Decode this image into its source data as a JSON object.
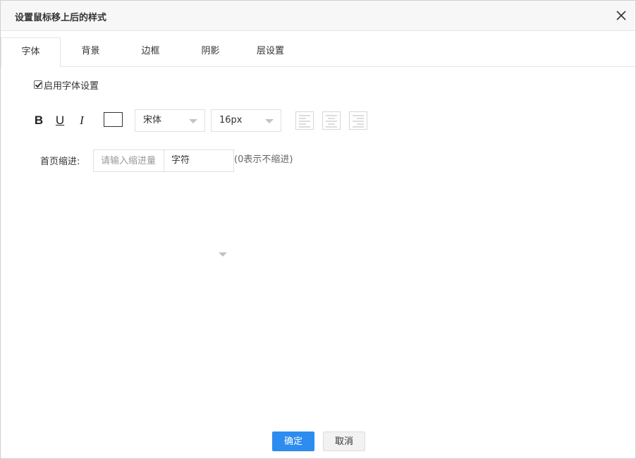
{
  "dialog": {
    "title": "设置鼠标移上后的样式"
  },
  "tabs": [
    {
      "label": "字体",
      "active": true
    },
    {
      "label": "背景",
      "active": false
    },
    {
      "label": "边框",
      "active": false
    },
    {
      "label": "阴影",
      "active": false
    },
    {
      "label": "层设置",
      "active": false
    }
  ],
  "font": {
    "enable_label": "启用字体设置",
    "enabled": true,
    "bold_label": "B",
    "underline_label": "U",
    "italic_label": "I",
    "text_color": "#ffffff",
    "font_family": "宋体",
    "font_size": "16px"
  },
  "indent": {
    "label": "首页缩进:",
    "placeholder": "请输入缩进量",
    "value": "",
    "unit": "字符",
    "hint": "(0表示不缩进)"
  },
  "footer": {
    "ok_label": "确定",
    "cancel_label": "取消"
  },
  "colors": {
    "accent": "#2d8cf0",
    "border": "#e0e0e0",
    "titlebar": "#f7f7f7"
  },
  "icons": {
    "close": "close-icon",
    "align_left": "align-left-icon",
    "align_center": "align-center-icon",
    "align_right": "align-right-icon",
    "dropdown": "chevron-down-icon"
  }
}
